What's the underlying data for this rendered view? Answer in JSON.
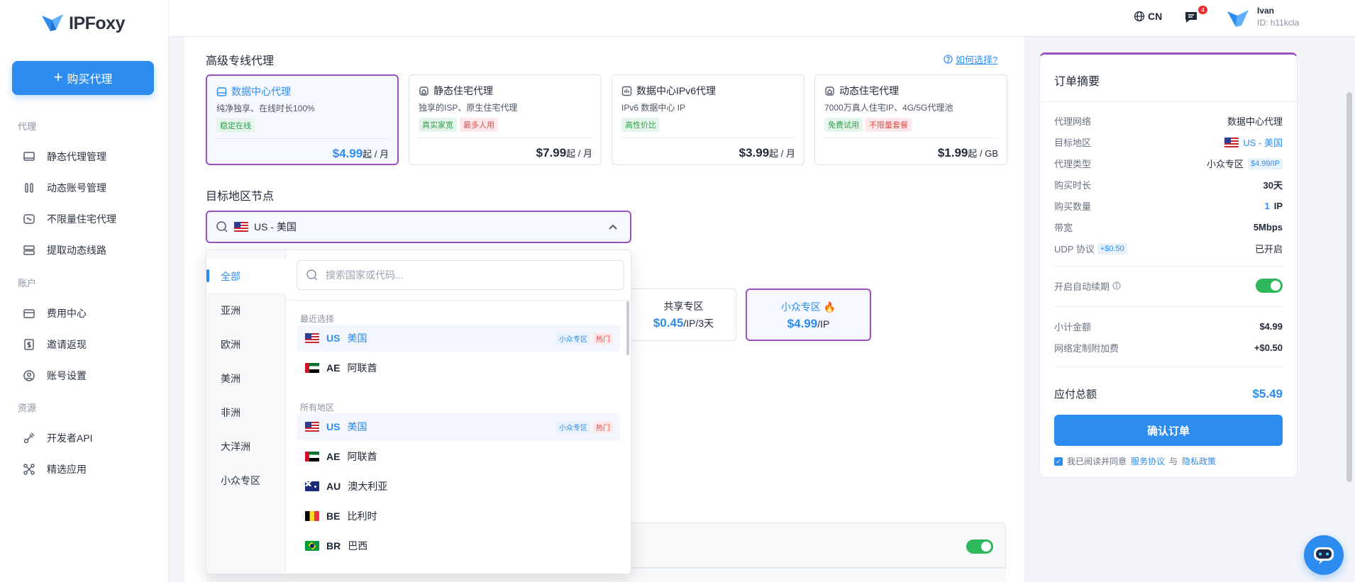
{
  "app": {
    "logo_text": "IPFoxy",
    "buy_button": "购买代理"
  },
  "sidebar": {
    "sections": [
      {
        "label": "代理",
        "items": [
          "静态代理管理",
          "动态账号管理",
          "不限量住宅代理",
          "提取动态线路"
        ]
      },
      {
        "label": "账户",
        "items": [
          "费用中心",
          "邀请返现",
          "账号设置"
        ]
      },
      {
        "label": "资源",
        "items": [
          "开发者API",
          "精选应用"
        ]
      }
    ]
  },
  "topbar": {
    "lang": "CN",
    "msg_count": "4",
    "user_name": "Ivan",
    "user_id": "ID: h11kcla"
  },
  "main": {
    "section_title": "高级专线代理",
    "help_link": "如何选择?",
    "cards": [
      {
        "title": "数据中心代理",
        "desc": "纯净独享、在线时长100%",
        "tags": [
          {
            "text": "稳定在线",
            "color": "green"
          }
        ],
        "price": "$4.99",
        "unit": "起 / 月"
      },
      {
        "title": "静态住宅代理",
        "desc": "独享的ISP、原生住宅代理",
        "tags": [
          {
            "text": "真实家宽",
            "color": "green"
          },
          {
            "text": "最多人用",
            "color": "red"
          }
        ],
        "price": "$7.99",
        "unit": "起 / 月"
      },
      {
        "title": "数据中心IPv6代理",
        "desc": "IPv6 数据中心 IP",
        "tags": [
          {
            "text": "高性价比",
            "color": "green"
          }
        ],
        "price": "$3.99",
        "unit": "起 / 月"
      },
      {
        "title": "动态住宅代理",
        "desc": "7000万真人住宅IP、4G/5G代理池",
        "tags": [
          {
            "text": "免费试用",
            "color": "green"
          },
          {
            "text": "不限量套餐",
            "color": "red"
          }
        ],
        "price": "$1.99",
        "unit": "起 / GB"
      }
    ],
    "region_title": "目标地区节点",
    "region_value": "US - 美国",
    "tiers": [
      {
        "name": "共享专区",
        "price": "$0.45",
        "unit": "/IP/3天"
      },
      {
        "name": "小众专区 🔥",
        "price": "$4.99",
        "unit": "/IP"
      }
    ]
  },
  "dropdown": {
    "categories": [
      "全部",
      "亚洲",
      "欧洲",
      "美洲",
      "非洲",
      "大洋洲",
      "小众专区"
    ],
    "search_placeholder": "搜索国家或代码...",
    "recent_label": "最近选择",
    "all_label": "所有地区",
    "recent": [
      {
        "flag": "us",
        "code": "US",
        "name": "美国",
        "tags": [
          "小众专区",
          "热门"
        ]
      },
      {
        "flag": "ae",
        "code": "AE",
        "name": "阿联酋",
        "tags": []
      }
    ],
    "all": [
      {
        "flag": "us",
        "code": "US",
        "name": "美国",
        "tags": [
          "小众专区",
          "热门"
        ]
      },
      {
        "flag": "ae",
        "code": "AE",
        "name": "阿联酋",
        "tags": []
      },
      {
        "flag": "au",
        "code": "AU",
        "name": "澳大利亚",
        "tags": []
      },
      {
        "flag": "be",
        "code": "BE",
        "name": "比利时",
        "tags": []
      },
      {
        "flag": "br",
        "code": "BR",
        "name": "巴西",
        "tags": []
      }
    ]
  },
  "summary": {
    "title": "订单摘要",
    "rows": [
      {
        "k": "代理网络",
        "v": "数据中心代理"
      },
      {
        "k": "目标地区",
        "v": "US - 美国"
      },
      {
        "k": "代理类型",
        "v": "小众专区",
        "chip": "$4.99/IP"
      },
      {
        "k": "购买时长",
        "v": "30天"
      },
      {
        "k": "购买数量",
        "v_num": "1",
        "v": "IP"
      },
      {
        "k": "带宽",
        "v": "5Mbps"
      },
      {
        "k": "UDP 协议",
        "k_chip": "+$0.50",
        "v": "已开启"
      }
    ],
    "auto_renew": "开启自动续期",
    "subtotal_label": "小计金额",
    "subtotal": "$4.99",
    "surcharge_label": "网络定制附加费",
    "surcharge": "+$0.50",
    "total_label": "应付总额",
    "total": "$5.49",
    "confirm": "确认订单",
    "agree_prefix": "我已阅读并同意",
    "terms": "服务协议",
    "and": "与",
    "privacy": "隐私政策"
  },
  "colors": {
    "accent": "#2d8cf0",
    "selected_border": "#9b51c0",
    "toggle_on": "#2eb85c"
  }
}
